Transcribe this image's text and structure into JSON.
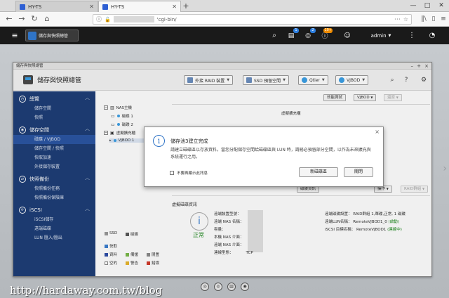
{
  "browser": {
    "tabs": [
      {
        "label": "HY-TS"
      },
      {
        "label": "HY-TS"
      }
    ],
    "new_tab": "+",
    "url": "'cgi-bin/",
    "window_controls": {
      "min": "—",
      "max": "□",
      "close": "✕"
    }
  },
  "qts_bar": {
    "task_label": "儲存與快照總管",
    "badges": {
      "tasks": "1",
      "events": "2",
      "notifications": "10+"
    },
    "user": "admin",
    "icons": [
      "menu-icon",
      "search-icon",
      "task-icon",
      "event-icon",
      "notification-icon",
      "user-icon",
      "more-icon",
      "dashboard-icon"
    ]
  },
  "app_window": {
    "window_title": "儲存與快照總管",
    "app_title": "儲存與快照總管",
    "header_buttons": {
      "external_raid": "外接 RAID 裝置",
      "ssd_overprovision": "SSD 預留空間",
      "qtier": "Qtier",
      "vjbod": "VJBOD"
    },
    "sidebar": [
      {
        "section": "總覽",
        "items": [
          "儲存空間",
          "快照"
        ]
      },
      {
        "section": "儲存空間",
        "items": [
          "磁碟 / VJBOD",
          "儲存空間 / 快照",
          "快取加速",
          "外接儲存裝置"
        ]
      },
      {
        "section": "快照備份",
        "items": [
          "快照備份任務",
          "快照備份保險庫"
        ]
      },
      {
        "section": "iSCSI",
        "items": [
          "iSCSI儲存",
          "遠端磁碟",
          "LUN 匯入/匯出"
        ]
      }
    ],
    "tree": {
      "nas_host": "NAS主機",
      "disk1": "磁碟 1",
      "disk2": "磁碟 2",
      "virtual_enclosure": "虛擬擴充櫃",
      "vjbod1": "VJBOD 1"
    },
    "legend": {
      "ssd": "SSD",
      "disk": "磁碟",
      "cache": "快取",
      "data": "資料",
      "spare": "備援",
      "free": "閒置",
      "empty": "空的",
      "warning": "警告",
      "error": "錯誤",
      "colors": {
        "ssd": "#9a9a9a",
        "disk": "#5a5a5a",
        "cache": "#3c7fd0",
        "data": "#2f4fa8",
        "spare": "#7bb94a",
        "free": "#8b8b8b",
        "empty": "#ffffff",
        "warning": "#e8b62d",
        "error": "#d23b2b"
      }
    },
    "main_toolbar": {
      "perf_test": "效能測試",
      "vjbod": "VJBOD",
      "restore": "還原"
    },
    "virtual_enclosure_title": "虛擬擴充櫃",
    "pool_toolbar": {
      "disk_info": "磁碟資訊",
      "action": "操作",
      "raid_group": "RAID群組"
    },
    "pool": {
      "title": "虛擬磁碟資訊",
      "status": "正常",
      "left": [
        {
          "k": "遠端裝置型號：",
          "v": ""
        },
        {
          "k": "遠端 NAS 名稱：",
          "v": ""
        },
        {
          "k": "容量：",
          "v": ""
        },
        {
          "k": "本機 NAS 介面：",
          "v": ""
        },
        {
          "k": "遠端 NAS 介面：",
          "v": ""
        },
        {
          "k": "連線型態：",
          "v": "TCP"
        }
      ],
      "right": [
        {
          "k": "遠端磁碟設置：",
          "v": "RAID群組 1,單碟,正常, 1 磁碟"
        },
        {
          "k": "遠端LUN名稱：",
          "v": "RemoteVJBOD1_0",
          "tag": "(啟動)"
        },
        {
          "k": "iSCSI 目標名稱：",
          "v": "RemoteVJBOD1",
          "tag": "(連線中)"
        }
      ]
    }
  },
  "dialog": {
    "title": "儲存池3建立完成",
    "message": "請建立磁碟區以存放資料。當您分配儲存空間給磁碟區與 LUN 時，請務必預留部分空間，以作為未來擴充與系統運行之用。",
    "dont_show": "不要再顯示此訊息",
    "new_volume": "新磁碟區",
    "close": "關閉"
  },
  "watermark": "http://hardaway.com.tw/blog"
}
